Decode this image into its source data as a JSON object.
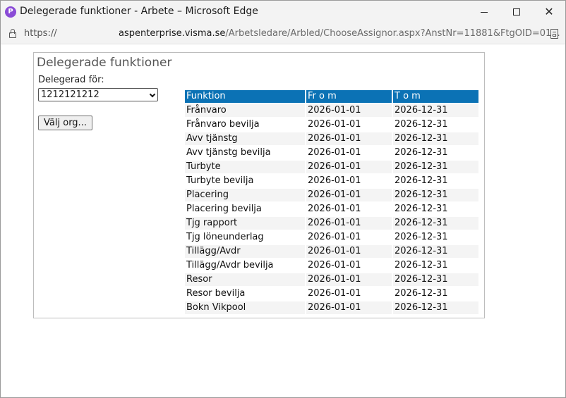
{
  "window": {
    "title": "Delegerade funktioner - Arbete – Microsoft Edge",
    "app_icon": "P",
    "url_scheme": "https://",
    "url_host": "aspenterprise.visma.se",
    "url_path": "/Arbetsledare/Arbled/ChooseAssignor.aspx?AnstNr=11881&FtgOID=01..."
  },
  "panel": {
    "title": "Delegerade funktioner",
    "delegated_for_label": "Delegerad för:",
    "delegated_for_value": "1212121212",
    "org_button_label": "Välj org..."
  },
  "table": {
    "headers": [
      "Funktion",
      "Fr o m",
      "T o m"
    ],
    "rows": [
      [
        "Frånvaro",
        "2026-01-01",
        "2026-12-31"
      ],
      [
        "Frånvaro bevilja",
        "2026-01-01",
        "2026-12-31"
      ],
      [
        "Avv tjänstg",
        "2026-01-01",
        "2026-12-31"
      ],
      [
        "Avv tjänstg bevilja",
        "2026-01-01",
        "2026-12-31"
      ],
      [
        "Turbyte",
        "2026-01-01",
        "2026-12-31"
      ],
      [
        "Turbyte bevilja",
        "2026-01-01",
        "2026-12-31"
      ],
      [
        "Placering",
        "2026-01-01",
        "2026-12-31"
      ],
      [
        "Placering bevilja",
        "2026-01-01",
        "2026-12-31"
      ],
      [
        "Tjg rapport",
        "2026-01-01",
        "2026-12-31"
      ],
      [
        "Tjg löneunderlag",
        "2026-01-01",
        "2026-12-31"
      ],
      [
        "Tillägg/Avdr",
        "2026-01-01",
        "2026-12-31"
      ],
      [
        "Tillägg/Avdr bevilja",
        "2026-01-01",
        "2026-12-31"
      ],
      [
        "Resor",
        "2026-01-01",
        "2026-12-31"
      ],
      [
        "Resor bevilja",
        "2026-01-01",
        "2026-12-31"
      ],
      [
        "Bokn Vikpool",
        "2026-01-01",
        "2026-12-31"
      ]
    ]
  },
  "colors": {
    "header_bg": "#0b72b5",
    "row_alt_bg": "#f4f4f4"
  }
}
